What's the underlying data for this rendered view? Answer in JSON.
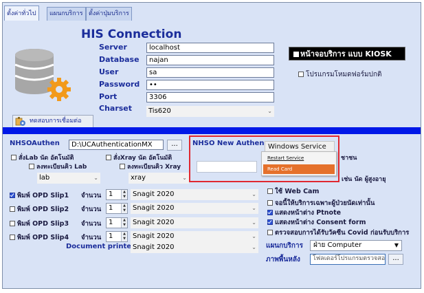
{
  "tabs": [
    "ตั้งค่าทั่วไป",
    "แผนกบริการ",
    "ตั้งค่าปุ่มบริการ"
  ],
  "upper": {
    "title": "HIS Connection",
    "labels": {
      "server": "Server",
      "database": "Database",
      "user": "User",
      "password": "Password",
      "port": "Port",
      "charset": "Charset"
    },
    "values": {
      "server": "localhost",
      "database": "najan",
      "user": "sa",
      "password": "••",
      "port": "3306",
      "charset": "Tis620"
    },
    "kiosk_label": "หน้าจอบริการ แบบ KIOSK",
    "normal_form_label": "โปรแกรมโหมดฟอร์มปกติ",
    "test_connection_label": "ทดสอบการเชื่อมต่อ"
  },
  "lower": {
    "nhso_authen_label": "NHSOAuthen",
    "nhso_authen_path": "D:\\UCAuthenticationMX",
    "browse_label": "...",
    "nhso_new_authen_label": "NHSO New Authen",
    "windows_service_label": "Windows Service ...",
    "menu_items": [
      "Restart Service",
      "Read Card"
    ],
    "lab_label": "สั่งLab นัด อัตโนมัติ",
    "lab_register_label": "ลงทะเบียนคิว Lab",
    "lab_value": "lab",
    "xray_label": "สั่งXray นัด อัตโนมัติ",
    "xray_register_label": "ลงทะเบียนคิว Xray",
    "xray_value": "xray",
    "print_rows": [
      {
        "label": "พิมพ์ OPD Slip1",
        "qty_label": "จำนวน",
        "qty": "1",
        "printer": "Snagit 2020",
        "checked": true
      },
      {
        "label": "พิมพ์ OPD Slip2",
        "qty_label": "จำนวน",
        "qty": "1",
        "printer": "Snagit 2020",
        "checked": false
      },
      {
        "label": "พิมพ์ OPD Slip3",
        "qty_label": "จำนวน",
        "qty": "1",
        "printer": "Snagit 2020",
        "checked": false
      },
      {
        "label": "พิมพ์ OPD Slip4",
        "qty_label": "จำนวน",
        "qty": "1",
        "printer": "Snagit 2020",
        "checked": false
      }
    ],
    "document_printer_label": "Document printer",
    "document_printer_value": "Snagit 2020",
    "right_partial_1": "ชาชน",
    "right_partial_2": "เช่น นัด ผู้สูงอายุ",
    "right_options": [
      {
        "label": "ใช้ Web Cam",
        "checked": false
      },
      {
        "label": "จอนี้ให้บริการเฉพาะผู้ป่วยนัดเท่านั้น",
        "checked": false
      },
      {
        "label": "แสดงหน้าต่าง Ptnote",
        "checked": true
      },
      {
        "label": "แสดงหน้าต่าง Consent form",
        "checked": true
      },
      {
        "label": "ตรวจสอบการได้รับวัคซีน Covid ก่อนรับบริการ",
        "checked": false
      }
    ],
    "service_dept_label": "แผนกบริการ",
    "service_dept_value": "ฝ่าย Computer",
    "background_label": "ภาพพื้นหลัง",
    "background_value": "โฟลเดอร์โปรแกรมตรวจสอ"
  },
  "colors": {
    "label_blue": "#1b2d9b",
    "divider_blue": "#0018e8",
    "highlight_red": "#e0272f",
    "menu_highlight": "#e5712b"
  }
}
